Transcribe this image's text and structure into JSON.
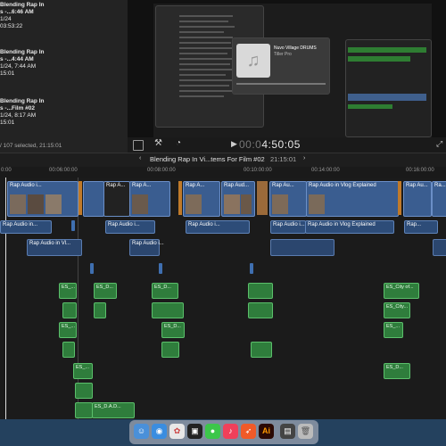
{
  "browser": {
    "items": [
      {
        "title": "Blending Rap In",
        "line2": "s -...6:46 AM",
        "line3": "1/24",
        "line4": "03:53:22"
      },
      {
        "title": "Blending Rap In",
        "line2": "s -...4:44 AM",
        "line3": "1/24",
        "line4": "15:01"
      },
      {
        "title": "Blending Rap In",
        "line2": "s -...Film #02",
        "line3": "1/24, 8:17 AM",
        "line4": "15:01"
      }
    ],
    "item1_extra": "1/24, 7:44 AM",
    "selection_status": "/ 107 selected, 21:15:01"
  },
  "viewer": {
    "timecode_dim": "00:0",
    "timecode": "4:50:05",
    "music_player": {
      "track": "Nuvo Village DRUMS",
      "artist": "Tiller Pro"
    }
  },
  "timeline": {
    "title": "Blending Rap In Vi...tems For Film #02",
    "duration": "21:15:01",
    "ruler": [
      "0:00",
      "00:06:00:00",
      "00:08:00:00",
      "00:10:00:00",
      "00:12:00:00",
      "00:14:00:00",
      "00:16:00:00"
    ],
    "video_clips": [
      "Rap Audio i...",
      "Rap A...",
      "Rap A...",
      "Rap A...",
      "Rap A...",
      "Rap Aud...",
      "Rap Au...",
      "Rap Audio in Vlog Explained",
      "Rap Au...",
      "Ra..."
    ],
    "audio_clips": [
      "Rap Audio in...",
      "Rap Audio i...",
      "Rap Audio i...",
      "Rap Audio i...",
      "Rap Audio in Vlog Explained",
      "Rap..."
    ],
    "audio_clips2": [
      "Rap Audio in Vl...",
      "Rap Audio i..."
    ],
    "sfx": [
      "ES_...",
      "ES_D...",
      "ES_D...",
      "ES_City of...",
      "ES_...",
      "ES_D...",
      "ES_...",
      "ES_City...",
      "ES_D...",
      "ES_...",
      "ES_D.A.D..."
    ]
  },
  "dock": {
    "icons": [
      "finder-icon",
      "safari-icon",
      "photos-icon",
      "fcp-icon",
      "messages-icon",
      "music-icon",
      "swift-icon",
      "illustrator-icon",
      "capture-icon",
      "trash-icon"
    ],
    "illustrator_label": "Ai"
  }
}
